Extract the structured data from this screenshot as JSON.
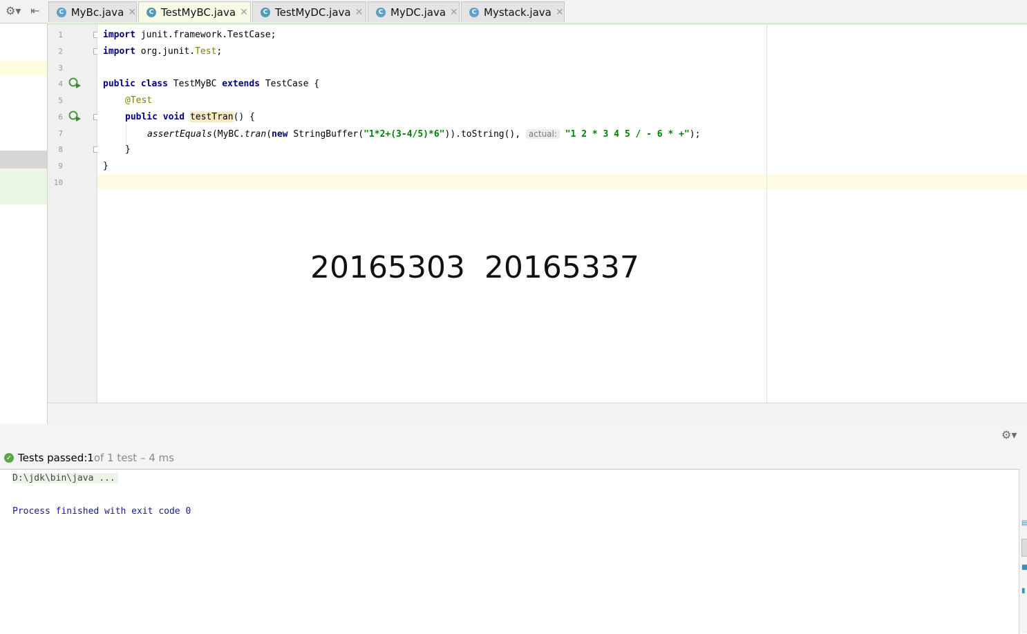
{
  "tabs": [
    {
      "label": "MyBc.java",
      "icon": "class-icon",
      "active": false
    },
    {
      "label": "TestMyBC.java",
      "icon": "test-class-icon",
      "active": true
    },
    {
      "label": "TestMyDC.java",
      "icon": "test-class-icon",
      "active": false
    },
    {
      "label": "MyDC.java",
      "icon": "class-icon",
      "active": false
    },
    {
      "label": "Mystack.java",
      "icon": "class-icon",
      "active": false
    }
  ],
  "toolbar": {
    "settings_icon": "gear-icon",
    "collapse_icon": "pin-left-icon"
  },
  "editor": {
    "line_numbers": [
      "1",
      "2",
      "3",
      "4",
      "5",
      "6",
      "7",
      "8",
      "9",
      "10"
    ],
    "code": {
      "l1_kw": "import",
      "l1_rest": " junit.framework.TestCase;",
      "l2_kw": "import",
      "l2_a": " org.junit.",
      "l2_cls": "Test",
      "l2_b": ";",
      "l4_kw1": "public",
      "l4_kw2": "class",
      "l4_name": " TestMyBC ",
      "l4_kw3": "extends",
      "l4_rest": " TestCase {",
      "l5_ann": "@Test",
      "l6_kw1": "public",
      "l6_kw2": "void",
      "l6_method": "testTran",
      "l6_rest": "() {",
      "l7_call": "assertEquals",
      "l7_a": "(MyBC.",
      "l7_tran": "tran",
      "l7_b": "(",
      "l7_kw": "new",
      "l7_c": " StringBuffer(",
      "l7_str1": "\"1*2+(3-4/5)*6\"",
      "l7_d": ")).toString(), ",
      "l7_hint": "actual:",
      "l7_str2": "\"1 2 * 3 4 5 / - 6 * +\"",
      "l7_e": ");",
      "l8": "}",
      "l9": "}"
    },
    "overlay_text": "20165303  20165337"
  },
  "run": {
    "status_label": "Tests passed: ",
    "status_count": "1",
    "status_rest": " of 1 test – 4 ms",
    "console_cmd": "D:\\jdk\\bin\\java ...",
    "console_exit": "Process finished with exit code 0"
  }
}
